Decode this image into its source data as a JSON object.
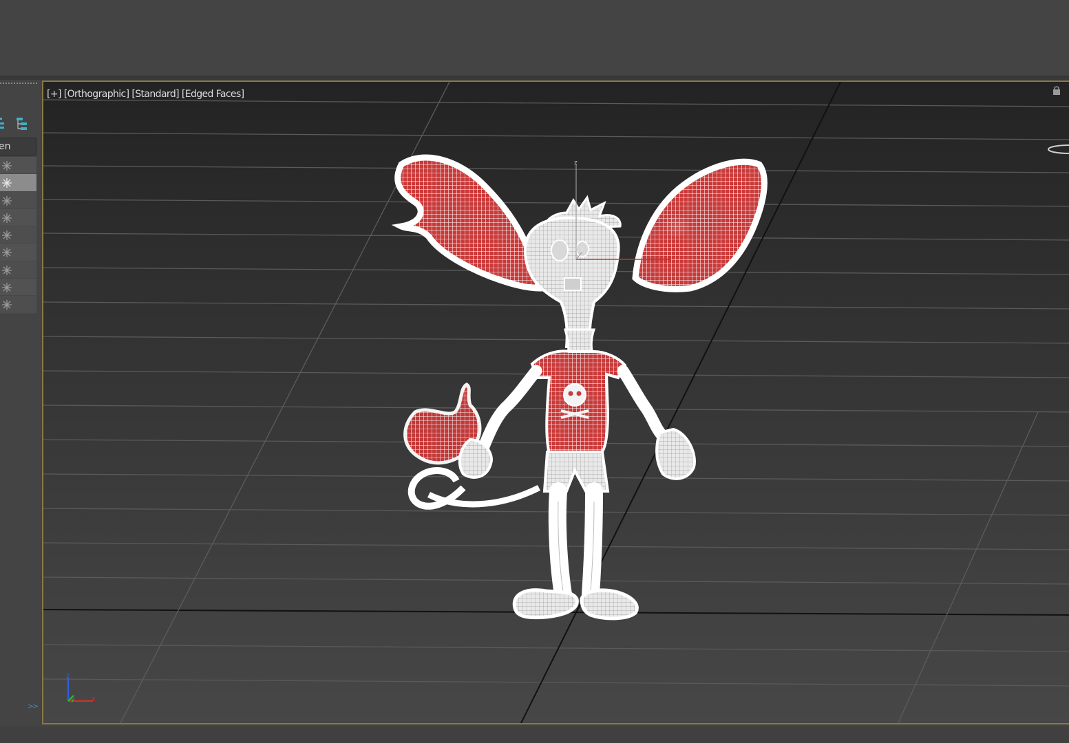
{
  "viewport": {
    "label_plus": "[+]",
    "label_view": "[Orthographic]",
    "label_shading": "[Standard]",
    "label_mode": "[Edged Faces]"
  },
  "scene_explorer": {
    "column_header": "en",
    "row_icon": "snowflake-icon",
    "rows": 9,
    "selected_row": 2
  },
  "axis_tripod": {
    "x_label": "x",
    "y_label": "y",
    "z_label": "z"
  },
  "gizmo": {
    "x_label": "x",
    "y_label": "y",
    "z_label": "z"
  },
  "colors": {
    "viewport_border": "#8a7a45",
    "wireframe": "#ffffff",
    "mesh_red": "#d23c3c"
  }
}
